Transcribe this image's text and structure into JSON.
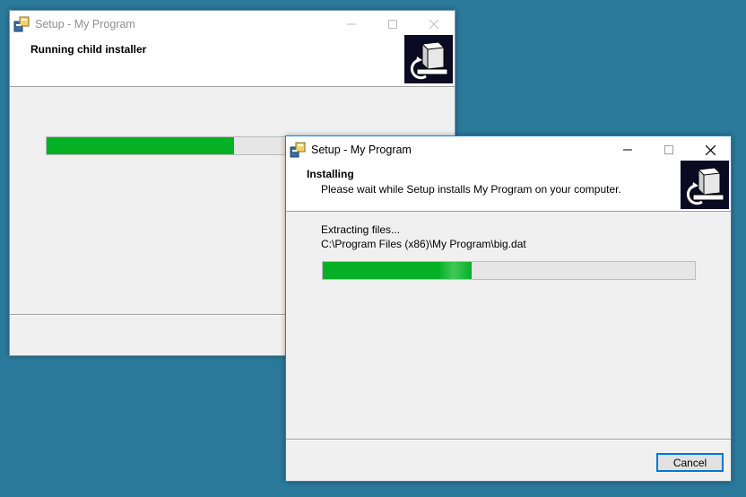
{
  "background_window": {
    "title": "Setup - My Program",
    "header_title": "Running child installer",
    "progress_percent": 50
  },
  "foreground_window": {
    "title": "Setup - My Program",
    "header_title": "Installing",
    "header_subtitle": "Please wait while Setup installs My Program on your computer.",
    "status_text": "Extracting files...",
    "file_path": "C:\\Program Files (x86)\\My Program\\big.dat",
    "progress_percent": 40,
    "cancel_label": "Cancel"
  },
  "colors": {
    "desktop": "#2b7a9b",
    "progress_fill": "#06b025",
    "accent_border": "#0078d7"
  },
  "icons": {
    "app": "setup-app-icon",
    "wizard": "computer-install-icon",
    "minimize": "minimize-icon",
    "maximize": "maximize-icon",
    "close": "close-icon"
  }
}
